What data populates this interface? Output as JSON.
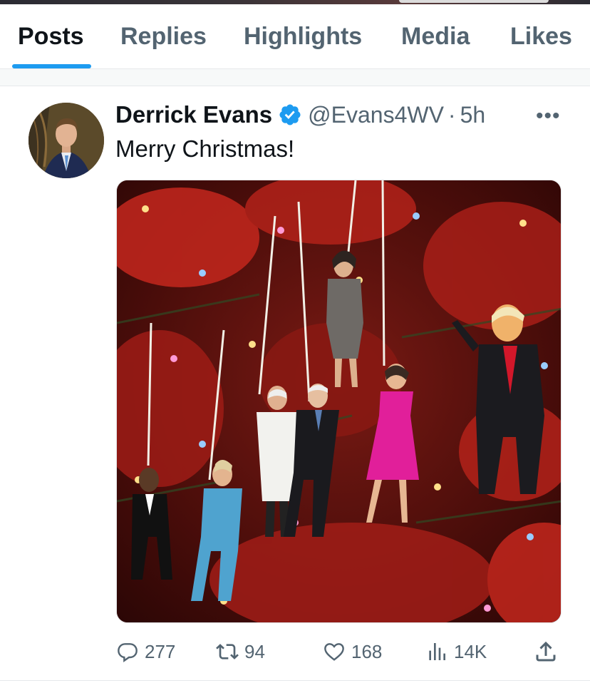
{
  "tabs": [
    {
      "label": "Posts",
      "active": true
    },
    {
      "label": "Replies",
      "active": false
    },
    {
      "label": "Highlights",
      "active": false
    },
    {
      "label": "Media",
      "active": false
    },
    {
      "label": "Likes",
      "active": false
    }
  ],
  "tweet": {
    "author_name": "Derrick Evans",
    "verified": true,
    "handle": "@Evans4WV",
    "separator": "·",
    "time": "5h",
    "more_label": "•••",
    "text": "Merry Christmas!",
    "media_icon": "photo-christmas-tree-with-figurine-ornaments",
    "actions": {
      "replies": "277",
      "reposts": "94",
      "likes": "168",
      "views": "14K"
    }
  },
  "colors": {
    "accent": "#1d9bf0",
    "text_primary": "#0f1419",
    "text_secondary": "#536471",
    "verified": "#1d9bf0"
  }
}
